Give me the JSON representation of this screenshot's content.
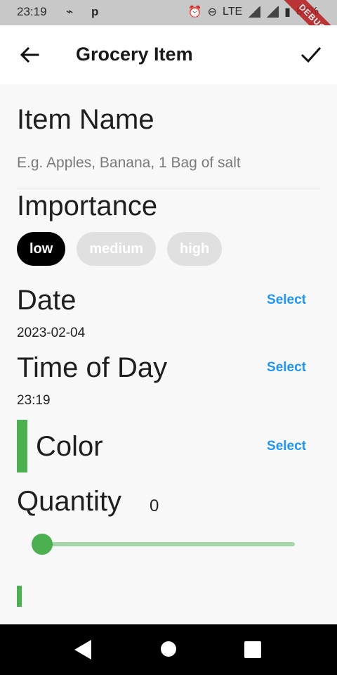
{
  "status": {
    "time": "23:19",
    "notifications": [
      "usb-icon",
      "p"
    ],
    "network": "LTE",
    "battery": "83%",
    "debug_banner": "DEBUG"
  },
  "app_bar": {
    "title": "Grocery Item",
    "back_icon": "arrow-left-icon",
    "confirm_icon": "check-icon"
  },
  "form": {
    "item_name_label": "Item Name",
    "item_name_placeholder": "E.g. Apples, Banana, 1 Bag of salt",
    "importance_label": "Importance",
    "importance_options": [
      "low",
      "medium",
      "high"
    ],
    "importance_selected": "low",
    "date_label": "Date",
    "date_value": "2023-02-04",
    "date_select": "Select",
    "time_label": "Time of Day",
    "time_value": "23:19",
    "time_select": "Select",
    "color_label": "Color",
    "color_select": "Select",
    "color_value": "#4caf50",
    "quantity_label": "Quantity",
    "quantity_value": "0",
    "quantity_fraction": 0
  },
  "nav": [
    "back-triangle-icon",
    "home-circle-icon",
    "recents-square-icon"
  ]
}
